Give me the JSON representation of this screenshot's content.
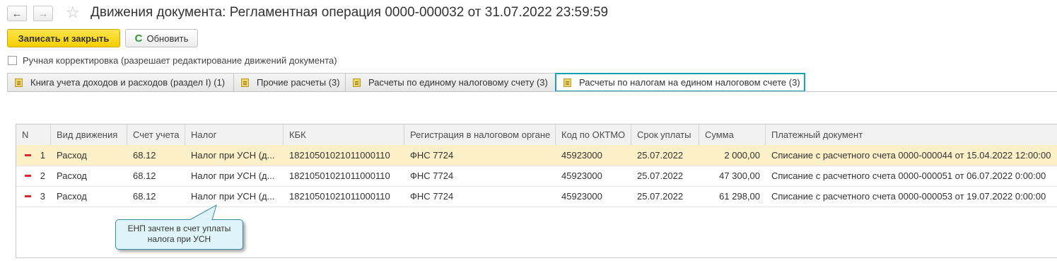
{
  "header": {
    "back_icon": "←",
    "forward_icon": "→",
    "favorite_icon": "☆",
    "title": "Движения документа: Регламентная операция 0000-000032 от 31.07.2022 23:59:59"
  },
  "toolbar": {
    "save_close_label": "Записать и закрыть",
    "refresh_label": "Обновить",
    "refresh_icon": "C"
  },
  "manual_edit": {
    "label": "Ручная корректировка (разрешает редактирование движений документа)",
    "checked": false
  },
  "tabs": [
    {
      "label": "Книга учета доходов и расходов (раздел I) (1)"
    },
    {
      "label": "Прочие расчеты (3)"
    },
    {
      "label": "Расчеты по единому налоговому счету (3)"
    },
    {
      "label": "Расчеты по налогам на едином налоговом счете (3)",
      "active": true
    }
  ],
  "table": {
    "columns": [
      "N",
      "Вид движения",
      "Счет учета",
      "Налог",
      "КБК",
      "Регистрация в налоговом органе",
      "Код по ОКТМО",
      "Срок уплаты",
      "Сумма",
      "Платежный документ"
    ],
    "rows": [
      [
        "1",
        "Расход",
        "68.12",
        "Налог при УСН (д...",
        "18210501021011000110",
        "ФНС 7724",
        "45923000",
        "25.07.2022",
        "2 000,00",
        "Списание с расчетного счета 0000-000044 от 15.04.2022 12:00:00"
      ],
      [
        "2",
        "Расход",
        "68.12",
        "Налог при УСН (д...",
        "18210501021011000110",
        "ФНС 7724",
        "45923000",
        "25.07.2022",
        "47 300,00",
        "Списание с расчетного счета 0000-000051 от 06.07.2022 0:00:00"
      ],
      [
        "3",
        "Расход",
        "68.12",
        "Налог при УСН (д...",
        "18210501021011000110",
        "ФНС 7724",
        "45923000",
        "25.07.2022",
        "61 298,00",
        "Списание с расчетного счета 0000-000053 от 19.07.2022 0:00:00"
      ]
    ],
    "selected_row": 1
  },
  "callout": {
    "line1": "ЕНП зачтен в счет уплаты",
    "line2": "налога при УСН"
  },
  "colors": {
    "accent_tab_border": "#17a2b8",
    "save_button": "#f5cf00",
    "selected_row": "#fbf0c7",
    "expense_marker": "#d8282a"
  }
}
